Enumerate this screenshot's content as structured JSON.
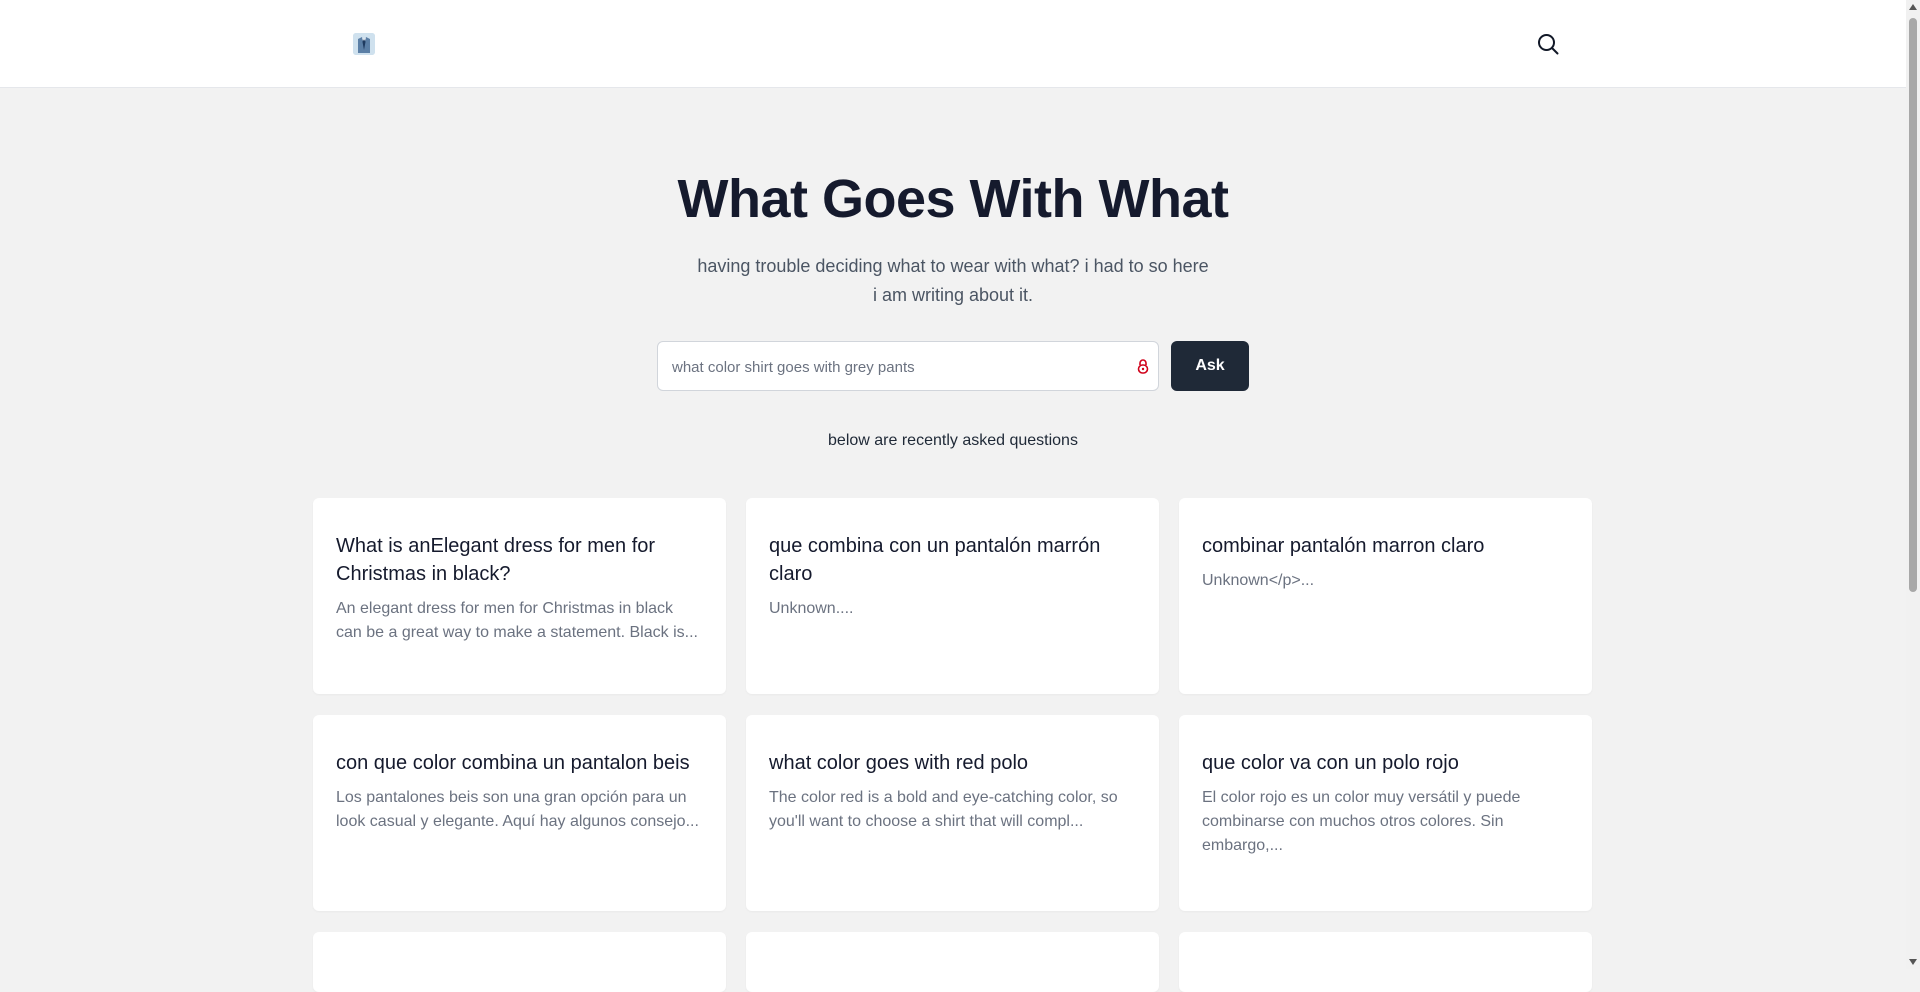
{
  "header": {
    "logo_icon": "shirt-tie-emoji-icon",
    "search_icon": "search-icon"
  },
  "hero": {
    "title": "What Goes With What",
    "subtitle": "having trouble deciding what to wear with what? i had to so here i am writing about it."
  },
  "ask": {
    "value": "what color shirt goes with grey pants",
    "button_label": "Ask",
    "input_icon": "red-lock-icon"
  },
  "recent": {
    "label": "below are recently asked questions",
    "cards": [
      {
        "title": "What is anElegant dress for men for Christmas in black?",
        "excerpt": "An elegant dress for men for Christmas in black can be a great way to make a statement. Black is..."
      },
      {
        "title": "que combina con un pantalón marrón claro",
        "excerpt": "Unknown...."
      },
      {
        "title": "combinar pantalón marron claro",
        "excerpt": "Unknown</p>..."
      },
      {
        "title": "con que color combina un pantalon beis",
        "excerpt": "Los pantalones beis son una gran opción para un look casual y elegante. Aquí hay algunos consejo..."
      },
      {
        "title": "what color goes with red polo",
        "excerpt": "The color red is a bold and eye-catching color, so you'll want to choose a shirt that will compl..."
      },
      {
        "title": "que color va con un polo rojo",
        "excerpt": "El color rojo es un color muy versátil y puede combinarse con muchos otros colores. Sin embargo,..."
      }
    ]
  },
  "colors": {
    "background": "#f2f2f2",
    "primary_button": "#1f2937",
    "title_text": "#151a2d",
    "muted_text": "#6b7280"
  }
}
